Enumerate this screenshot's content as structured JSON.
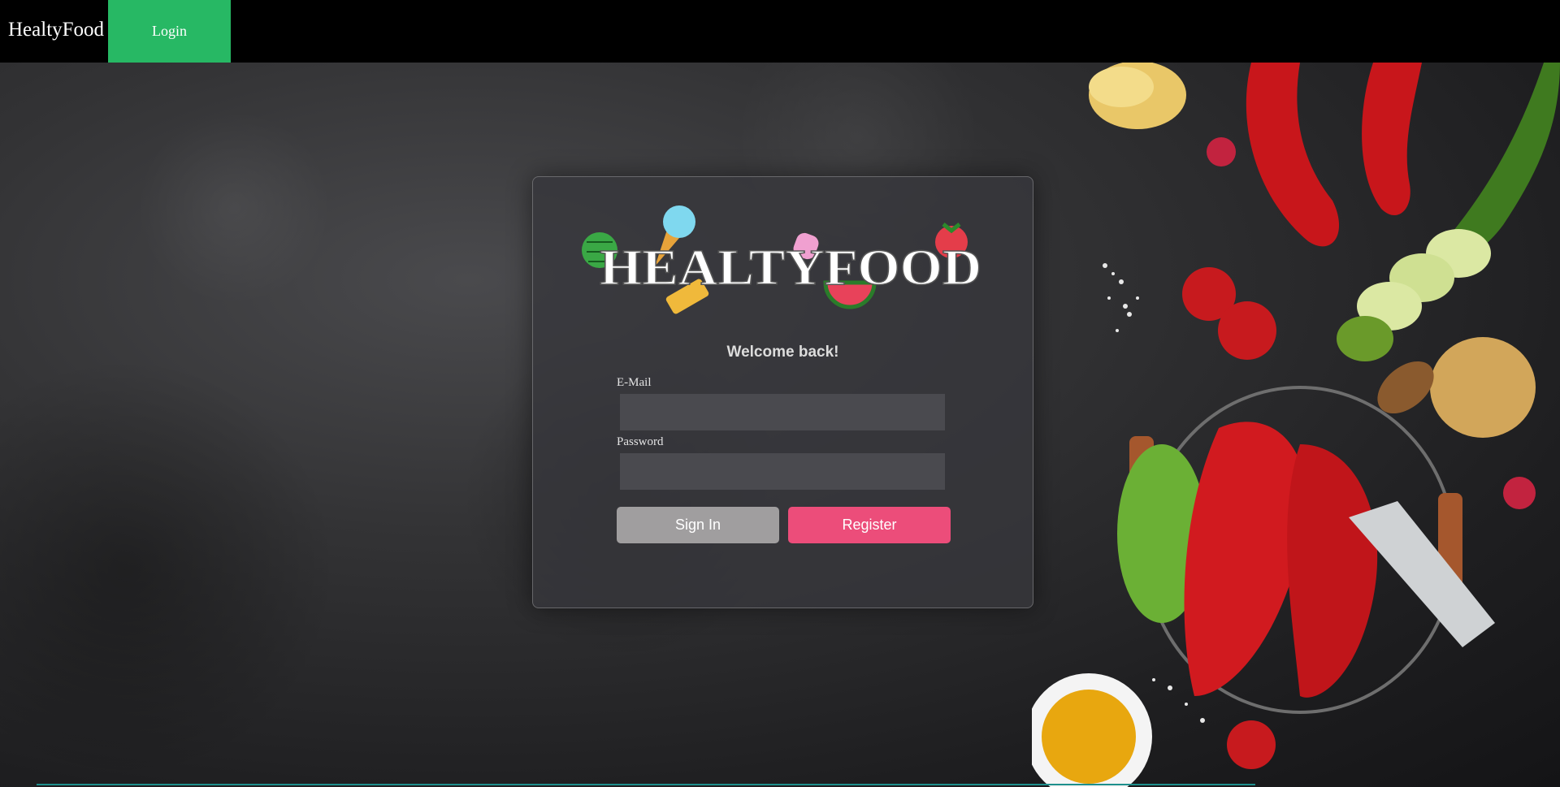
{
  "navbar": {
    "brand": "HealtyFood",
    "login_label": "Login"
  },
  "login_card": {
    "logo_text": "HEALTYFOOD",
    "welcome": "Welcome back!",
    "email_label": "E-Mail",
    "email_value": "",
    "password_label": "Password",
    "password_value": "",
    "sign_in_label": "Sign In",
    "register_label": "Register"
  },
  "colors": {
    "navbar_bg": "#000000",
    "nav_login_bg": "#27b864",
    "sign_in_bg": "#a09e9f",
    "register_bg": "#ec4d7a"
  }
}
